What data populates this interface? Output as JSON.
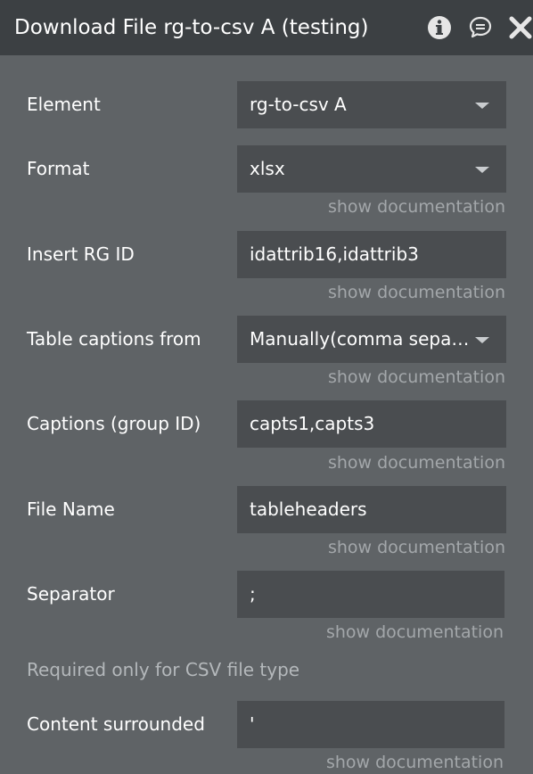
{
  "header": {
    "title": "Download File rg-to-csv A (testing)",
    "info_icon": "info-icon",
    "comment_icon": "comment-icon",
    "close_icon": "close-icon"
  },
  "fields": {
    "element": {
      "label": "Element",
      "value": "rg-to-csv A"
    },
    "format": {
      "label": "Format",
      "value": "xlsx",
      "doc": "show documentation"
    },
    "insert_rg_id": {
      "label": "Insert RG ID",
      "value": "idattrib16,idattrib3",
      "doc": "show documentation"
    },
    "table_captions_from": {
      "label": "Table captions from",
      "value": "Manually(comma separ…",
      "doc": "show documentation"
    },
    "captions_group_id": {
      "label": "Captions (group ID)",
      "value": "capts1,capts3",
      "doc": "show documentation"
    },
    "file_name": {
      "label": "File Name",
      "value": "tableheaders",
      "doc": "show documentation"
    },
    "separator": {
      "label": "Separator",
      "value": ";",
      "doc": "show documentation",
      "note": "Required only for CSV file type"
    },
    "content_surrounded": {
      "label": "Content surrounded",
      "value": "'",
      "doc": "show documentation"
    }
  },
  "colors": {
    "header_bg": "#3c4043",
    "panel_bg": "#5f6366",
    "field_bg": "#4a4d50",
    "doc_link": "#a3a7aa"
  }
}
